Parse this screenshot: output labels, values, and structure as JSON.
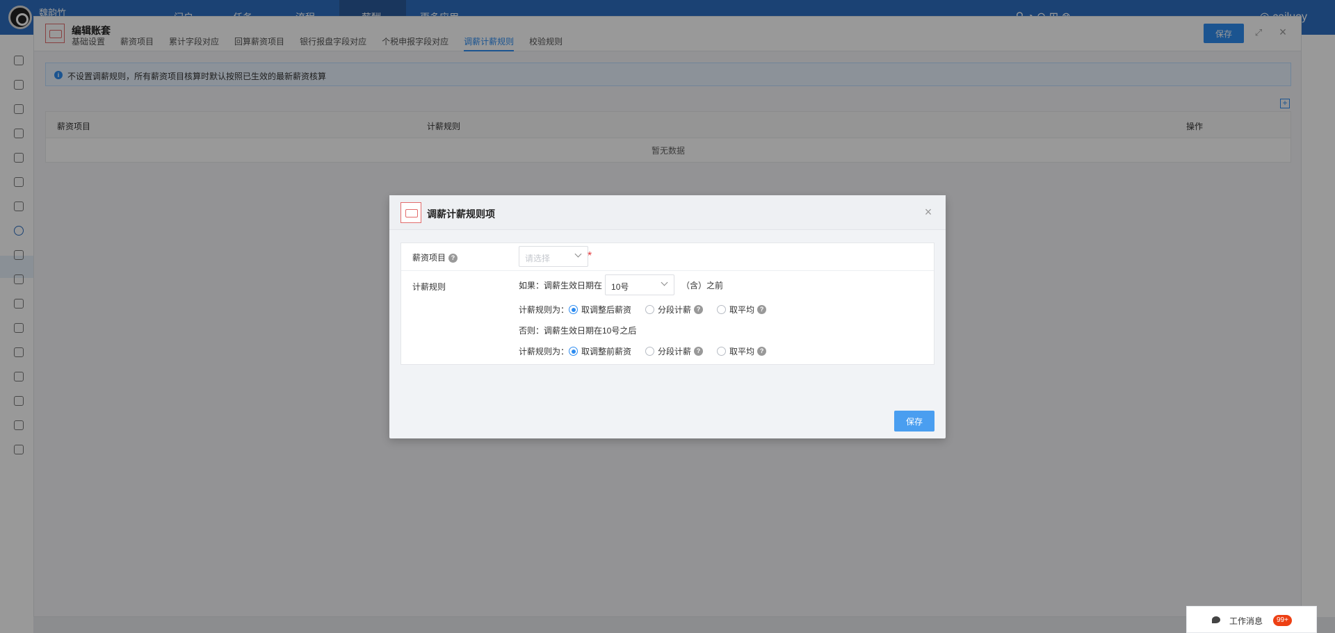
{
  "app": {
    "user": "魏韵竹",
    "nav": [
      "门户",
      "任务",
      "流程",
      "薪酬",
      "更多应用"
    ],
    "top_user": "cailuoy"
  },
  "drawer": {
    "title": "编辑账套",
    "save_label": "保存",
    "tabs": [
      {
        "label": "基础设置"
      },
      {
        "label": "薪资项目"
      },
      {
        "label": "累计字段对应"
      },
      {
        "label": "回算薪资项目"
      },
      {
        "label": "银行报盘字段对应"
      },
      {
        "label": "个税申报字段对应"
      },
      {
        "label": "调薪计薪规则",
        "active": true
      },
      {
        "label": "校验规则"
      }
    ],
    "info": "不设置调薪规则，所有薪资项目核算时默认按照已生效的最新薪资核算",
    "table": {
      "columns": [
        "薪资项目",
        "计薪规则",
        "操作"
      ],
      "empty": "暂无数据"
    }
  },
  "modal": {
    "title": "调薪计薪规则项",
    "salary_item_label": "薪资项目",
    "salary_item_placeholder": "请选择",
    "rule_label": "计薪规则",
    "if_prefix": "如果：调薪生效日期在",
    "day_value": "10号",
    "if_suffix": "（含）之前",
    "rule_prefix": "计薪规则为：",
    "options_before": [
      "取调整后薪资",
      "分段计薪",
      "取平均"
    ],
    "else_text": "否则：调薪生效日期在10号之后",
    "options_after": [
      "取调整前薪资",
      "分段计薪",
      "取平均"
    ],
    "save_label": "保存"
  },
  "message": {
    "label": "工作消息",
    "badge": "99+"
  },
  "colors": {
    "primary": "#2d8cf0",
    "topbar": "#2d6fc1",
    "required": "#e4393c",
    "badge": "#ed4014"
  }
}
